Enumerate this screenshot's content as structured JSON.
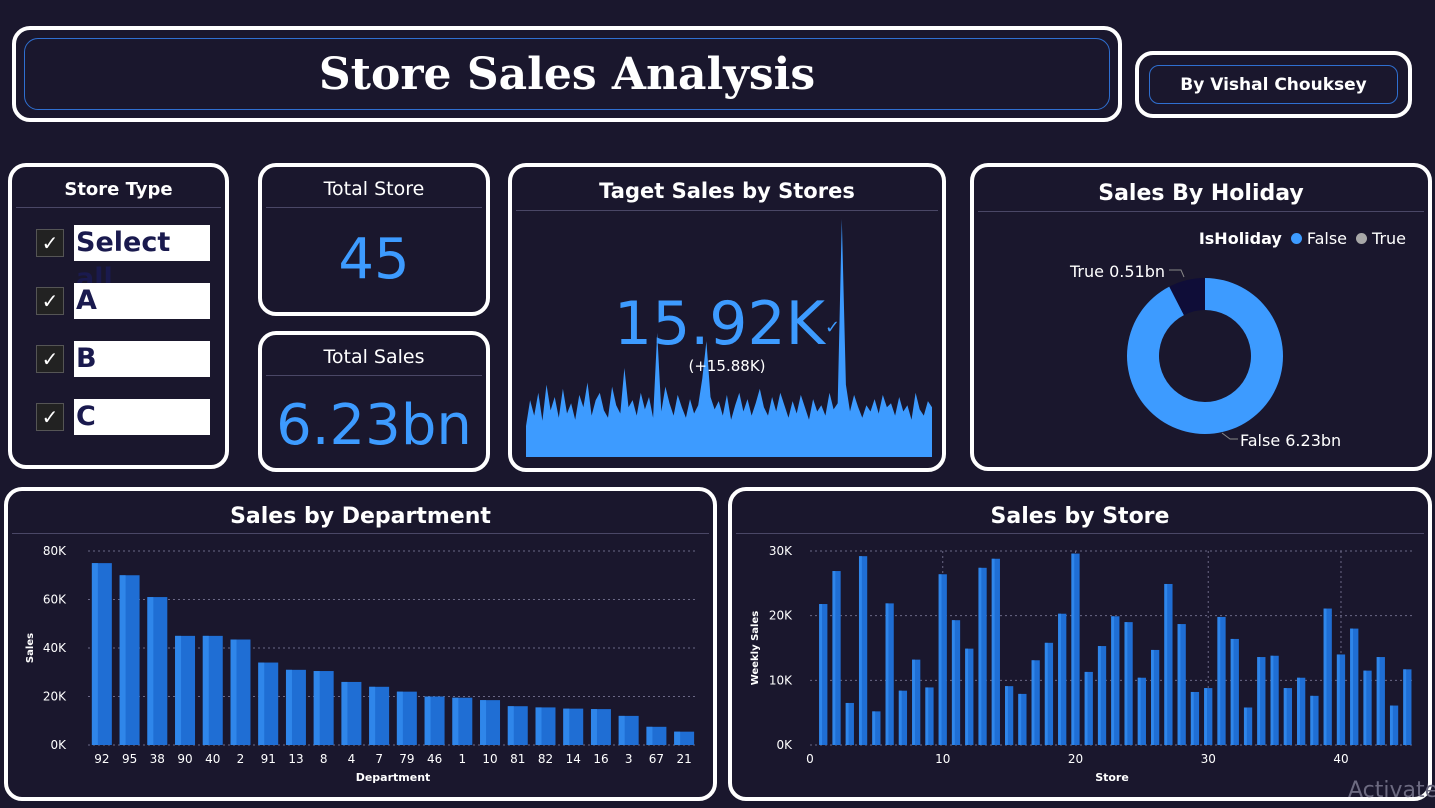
{
  "header": {
    "title": "Store Sales Analysis",
    "author": "By Vishal Chouksey"
  },
  "slicer": {
    "title": "Store Type",
    "items": [
      {
        "label": "Select all",
        "checked": true
      },
      {
        "label": "A",
        "checked": true
      },
      {
        "label": "B",
        "checked": true
      },
      {
        "label": "C",
        "checked": true
      }
    ]
  },
  "kpis": {
    "total_store": {
      "title": "Total Store",
      "value": "45"
    },
    "total_sales": {
      "title": "Total Sales",
      "value": "6.23bn"
    }
  },
  "target": {
    "title": "Taget Sales by Stores",
    "value": "15.92K",
    "delta": "(+15.88K)"
  },
  "holiday": {
    "title": "Sales By Holiday",
    "legend_title": "IsHoliday",
    "legend_false": "False",
    "legend_true": "True",
    "label_true": "True 0.51bn",
    "label_false": "False 6.23bn"
  },
  "colors": {
    "accent": "#3d9bff",
    "bar": "#1f6ed4",
    "background": "#1a172d",
    "holiday_true": "#0f0d38"
  },
  "chart_data": [
    {
      "type": "pie",
      "title": "Sales By Holiday",
      "categories": [
        "False",
        "True"
      ],
      "values": [
        6.23,
        0.51
      ],
      "unit": "bn",
      "legend": "top-right"
    },
    {
      "type": "bar",
      "title": "Sales by Department",
      "xlabel": "Department",
      "ylabel": "Sales",
      "categories": [
        "92",
        "95",
        "38",
        "90",
        "40",
        "2",
        "91",
        "13",
        "8",
        "4",
        "7",
        "79",
        "46",
        "1",
        "10",
        "81",
        "82",
        "14",
        "16",
        "3",
        "67",
        "21"
      ],
      "values": [
        75000,
        70000,
        61000,
        45000,
        45000,
        43500,
        34000,
        31000,
        30500,
        26000,
        24000,
        22000,
        20000,
        19500,
        18500,
        16000,
        15500,
        15000,
        14800,
        12000,
        7500,
        5500
      ],
      "ylim": [
        0,
        80000
      ],
      "yticks": [
        "0K",
        "20K",
        "40K",
        "60K",
        "80K"
      ],
      "grid": true
    },
    {
      "type": "bar",
      "title": "Sales by Store",
      "xlabel": "Store",
      "ylabel": "Weekly Sales",
      "x": [
        1,
        2,
        3,
        4,
        5,
        6,
        7,
        8,
        9,
        10,
        11,
        12,
        13,
        14,
        15,
        16,
        17,
        18,
        19,
        20,
        21,
        22,
        23,
        24,
        25,
        26,
        27,
        28,
        29,
        30,
        31,
        32,
        33,
        34,
        35,
        36,
        37,
        38,
        39,
        40,
        41,
        42,
        43,
        44,
        45
      ],
      "values": [
        21800,
        26900,
        6500,
        29200,
        5200,
        21900,
        8400,
        13200,
        8900,
        26400,
        19300,
        14900,
        27400,
        28800,
        9100,
        7900,
        13100,
        15800,
        20300,
        29600,
        11300,
        15300,
        19900,
        19000,
        10400,
        14700,
        24900,
        18700,
        8200,
        8800,
        19800,
        16400,
        5800,
        13600,
        13800,
        8800,
        10400,
        7600,
        21100,
        14000,
        18000,
        11500,
        13600,
        6100,
        11700
      ],
      "xticks": [
        "0",
        "10",
        "20",
        "30",
        "40"
      ],
      "ylim": [
        0,
        30000
      ],
      "yticks": [
        "0K",
        "10K",
        "20K",
        "30K"
      ],
      "grid": true
    },
    {
      "type": "area",
      "title": "Taget Sales by Stores",
      "x": [
        1,
        2,
        3,
        4,
        5,
        6,
        7,
        8,
        9,
        10,
        11,
        12,
        13,
        14,
        15,
        16,
        17,
        18,
        19,
        20,
        21,
        22,
        23,
        24,
        25,
        26,
        27,
        28,
        29,
        30,
        31,
        32,
        33,
        34,
        35,
        36,
        37,
        38,
        39,
        40,
        41,
        42,
        43,
        44,
        45,
        46,
        47,
        48,
        49,
        50,
        51,
        52,
        53,
        54,
        55,
        56,
        57,
        58,
        59,
        60,
        61,
        62,
        63,
        64,
        65,
        66,
        67,
        68,
        69,
        70,
        71,
        72,
        73,
        74,
        75,
        76,
        77,
        78,
        79,
        80,
        81,
        82,
        83,
        84,
        85,
        86,
        87,
        88,
        89,
        90,
        91,
        92,
        93,
        94,
        95,
        96,
        97,
        98,
        99,
        100
      ],
      "values": [
        30,
        55,
        40,
        62,
        35,
        70,
        45,
        58,
        38,
        66,
        42,
        52,
        36,
        60,
        48,
        72,
        40,
        55,
        62,
        45,
        38,
        68,
        50,
        42,
        86,
        48,
        55,
        40,
        62,
        46,
        58,
        38,
        120,
        44,
        68,
        52,
        40,
        60,
        48,
        38,
        56,
        42,
        50,
        76,
        112,
        58,
        46,
        54,
        40,
        60,
        36,
        50,
        62,
        44,
        56,
        40,
        52,
        66,
        48,
        40,
        58,
        44,
        62,
        50,
        38,
        54,
        42,
        60,
        48,
        36,
        56,
        44,
        50,
        40,
        62,
        46,
        52,
        230,
        70,
        44,
        60,
        48,
        38,
        50,
        44,
        56,
        42,
        60,
        48,
        52,
        40,
        58,
        44,
        50,
        36,
        62,
        46,
        40,
        54,
        48
      ],
      "grid": false
    }
  ]
}
